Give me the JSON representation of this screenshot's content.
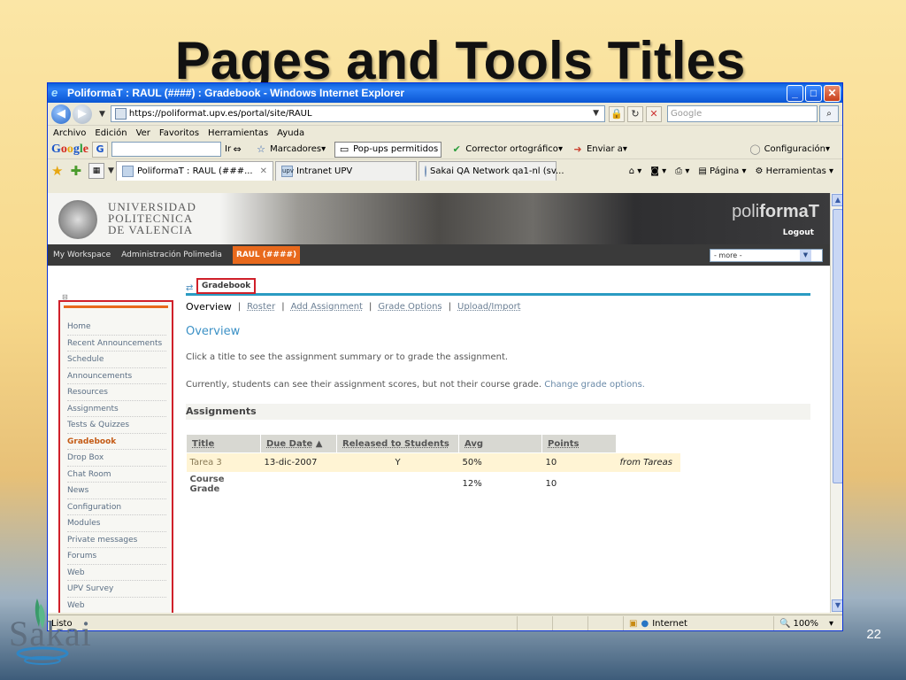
{
  "slide": {
    "title": "Pages and Tools Titles",
    "number": "22",
    "logo_text": "Sakai"
  },
  "window": {
    "title": "PoliformaT : RAUL (####) : Gradebook - Windows Internet Explorer",
    "minimize": "_",
    "maximize": "□",
    "close": "✕"
  },
  "address": {
    "url": "https://poliformat.upv.es/portal/site/RAUL",
    "search_placeholder": "Google"
  },
  "menu": [
    "Archivo",
    "Edición",
    "Ver",
    "Favoritos",
    "Herramientas",
    "Ayuda"
  ],
  "google_toolbar": {
    "go": "Ir",
    "bookmarks": "Marcadores",
    "popups": "Pop-ups permitidos",
    "spellcheck": "Corrector ortográfico",
    "send": "Enviar a",
    "settings": "Configuración"
  },
  "tabs": [
    {
      "label": "PoliformaT : RAUL (###...",
      "icon": "page-icon",
      "active": true
    },
    {
      "label": "Intranet UPV",
      "icon": "upv-icon",
      "active": false
    },
    {
      "label": "Sakai QA Network qa1-nl (sv...",
      "icon": "sakai-icon",
      "active": false
    }
  ],
  "tab_tools": {
    "page": "Página",
    "tools": "Herramientas"
  },
  "banner": {
    "university_line1": "UNIVERSIDAD",
    "university_line2": "POLITECNICA",
    "university_line3": "DE VALENCIA",
    "brand_light": "poli",
    "brand_bold": "formaT",
    "logout": "Logout"
  },
  "site_nav": {
    "items": [
      "My Workspace",
      "Administración Polimedia"
    ],
    "active": "RAUL (####)",
    "more": "- more -"
  },
  "left_nav": {
    "items": [
      "Home",
      "Recent Announcements",
      "Schedule",
      "Announcements",
      "Resources",
      "Assignments",
      "Tests & Quizzes",
      "Gradebook",
      "Drop Box",
      "Chat Room",
      "News",
      "Configuration",
      "Modules",
      "Private messages",
      "Forums",
      "Web",
      "UPV Survey",
      "Web"
    ],
    "current": "Gradebook"
  },
  "tool": {
    "title": "Gradebook",
    "toolbar": {
      "overview": "Overview",
      "roster": "Roster",
      "add_assignment": "Add Assignment",
      "grade_options": "Grade Options",
      "upload_import": "Upload/Import"
    },
    "section_title": "Overview",
    "para1": "Click a title to see the assignment summary or to grade the assignment.",
    "para2": "Currently, students can see their assignment scores, but not their course grade.",
    "para2_link": "Change grade options.",
    "assignments_heading": "Assignments",
    "table": {
      "headers": [
        "Title",
        "Due Date",
        "Released to Students",
        "Avg",
        "Points"
      ],
      "rows": [
        [
          "Tarea 3",
          "13-dic-2007",
          "Y",
          "50%",
          "10",
          "from Tareas"
        ],
        [
          "Course Grade",
          "",
          "",
          "12%",
          "10",
          ""
        ]
      ]
    }
  },
  "status": {
    "left": "Listo",
    "zone": "Internet",
    "zoom": "100%"
  },
  "colors": {
    "accent_orange": "#e8691c",
    "highlight_red": "#d0202a",
    "accent_blue": "#2a9bc2"
  }
}
